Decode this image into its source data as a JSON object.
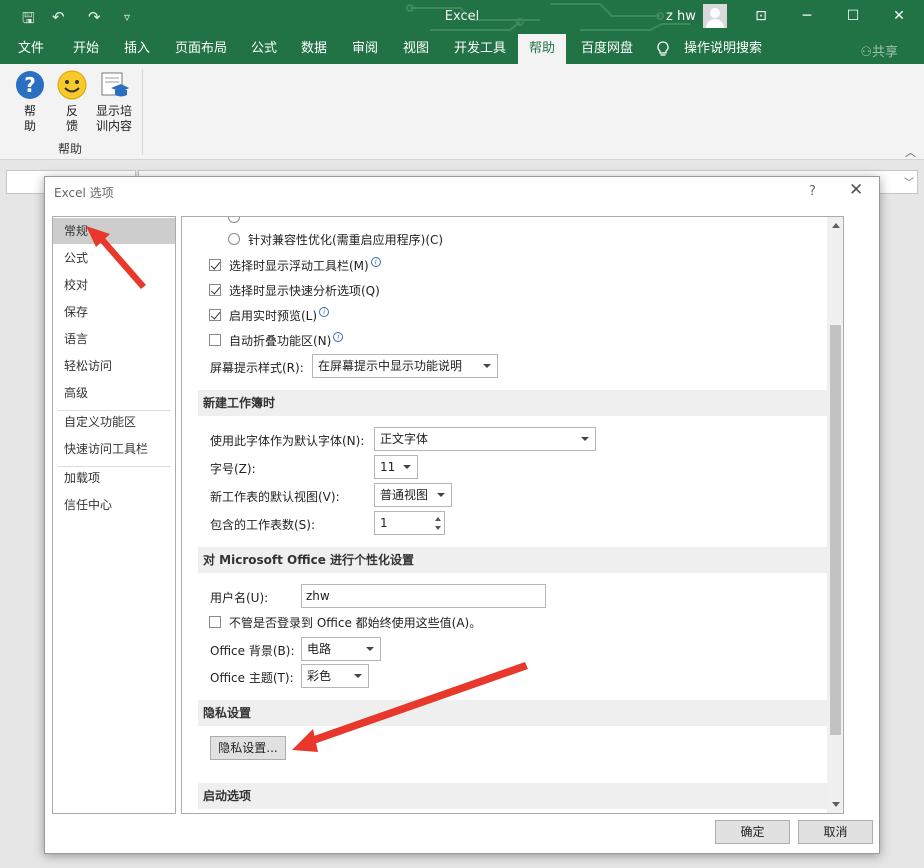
{
  "window": {
    "title": "Excel",
    "user": "z hw",
    "minimize": "─",
    "maximize": "☐",
    "close": "✕",
    "restore_ribbon": "⊡"
  },
  "quick_access": {
    "save": "🖫",
    "undo": "↶",
    "redo": "↷",
    "customize": "▿"
  },
  "tabs": [
    "文件",
    "开始",
    "插入",
    "页面布局",
    "公式",
    "数据",
    "审阅",
    "视图",
    "开发工具",
    "帮助",
    "百度网盘",
    "操作说明搜索"
  ],
  "active_tab": "帮助",
  "share": "共享",
  "ribbon": {
    "help": {
      "line1": "帮",
      "line2": "助"
    },
    "feedback": {
      "line1": "反",
      "line2": "馈"
    },
    "training": {
      "line1": "显示培",
      "line2": "训内容"
    },
    "group_label": "帮助"
  },
  "dialog": {
    "title": "Excel 选项",
    "help": "?",
    "close": "✕",
    "nav": [
      "常规",
      "公式",
      "校对",
      "保存",
      "语言",
      "轻松访问",
      "高级",
      "自定义功能区",
      "快速访问工具栏",
      "加载项",
      "信任中心"
    ],
    "selected_nav": "常规",
    "options": {
      "radio_optimize_display": "针对兼容性优化(需重启应用程序)(C)",
      "mini_toolbar": "选择时显示浮动工具栏(M)",
      "quick_analysis": "选择时显示快速分析选项(Q)",
      "live_preview": "启用实时预览(L)",
      "auto_collapse": "自动折叠功能区(N)",
      "screentip_label": "屏幕提示样式(R):",
      "screentip_value": "在屏幕提示中显示功能说明"
    },
    "new_workbook": {
      "header": "新建工作簿时",
      "font_label": "使用此字体作为默认字体(N):",
      "font_value": "正文字体",
      "size_label": "字号(Z):",
      "size_value": "11",
      "view_label": "新工作表的默认视图(V):",
      "view_value": "普通视图",
      "sheets_label": "包含的工作表数(S):",
      "sheets_value": "1"
    },
    "personalize": {
      "header": "对 Microsoft Office 进行个性化设置",
      "username_label": "用户名(U):",
      "username_value": "zhw",
      "always_use": "不管是否登录到 Office 都始终使用这些值(A)。",
      "background_label": "Office 背景(B):",
      "background_value": "电路",
      "theme_label": "Office 主题(T):",
      "theme_value": "彩色"
    },
    "privacy": {
      "header": "隐私设置",
      "button": "隐私设置..."
    },
    "startup": {
      "header": "启动选项"
    },
    "ok": "确定",
    "cancel": "取消"
  },
  "colors": {
    "excel_green": "#217346",
    "annotation_red": "#e8382b"
  }
}
